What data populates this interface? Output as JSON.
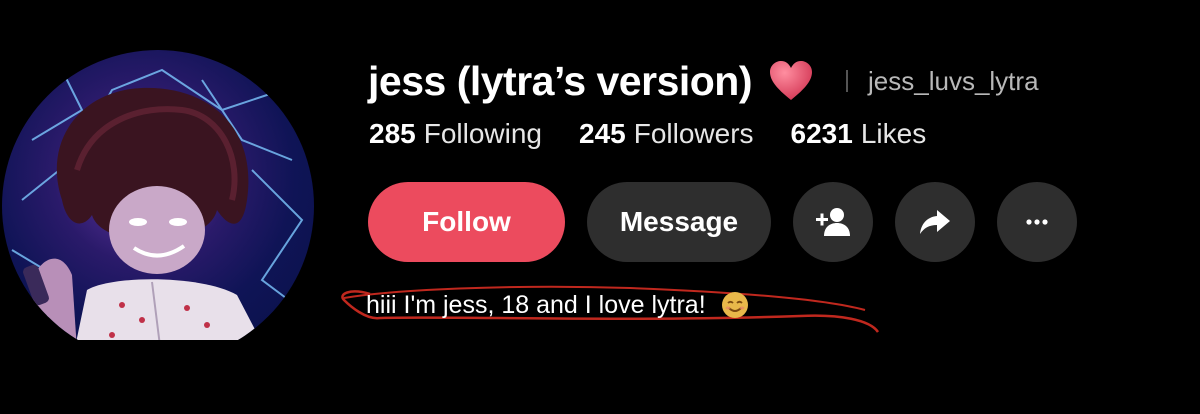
{
  "profile": {
    "display_name": "jess (lytra’s version)",
    "username": "jess_luvs_lytra",
    "bio": "hiii I'm jess, 18 and I love lytra!"
  },
  "stats": [
    {
      "value": "285",
      "label": "Following"
    },
    {
      "value": "245",
      "label": "Followers"
    },
    {
      "value": "6231",
      "label": "Likes"
    }
  ],
  "actions": {
    "follow_label": "Follow",
    "message_label": "Message",
    "add_friend_icon": "add-friend-icon",
    "share_icon": "share-icon",
    "more_icon": "more-icon"
  },
  "colors": {
    "background": "#000000",
    "follow_button": "#ec4b5e",
    "secondary_button": "#2e2e2e",
    "heart": "#e8556e",
    "scribble": "#c0281e"
  }
}
